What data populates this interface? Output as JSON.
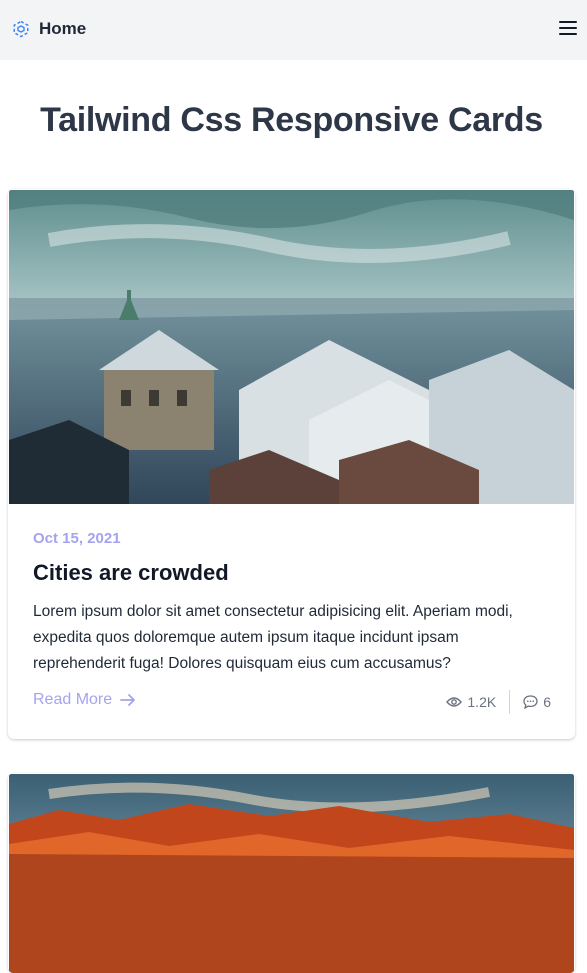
{
  "nav": {
    "brand_label": "Home",
    "brand_icon": "hexagon-cube-icon",
    "menu_icon": "hamburger-menu-icon",
    "accent_color": "#3b82f6"
  },
  "page": {
    "title": "Tailwind Css Responsive Cards"
  },
  "cards": [
    {
      "image": "city-rooftops-photo",
      "date": "Oct 15, 2021",
      "title": "Cities are crowded",
      "text": "Lorem ipsum dolor sit amet consectetur adipisicing elit. Aperiam modi, expedita quos doloremque autem ipsum itaque incidunt ipsam reprehenderit fuga! Dolores quisquam eius cum accusamus?",
      "read_more": "Read More",
      "views": "1.2K",
      "comments": "6"
    },
    {
      "image": "red-rock-landscape-photo"
    }
  ],
  "colors": {
    "date": "#a5a3f0",
    "link": "#a5a3f0",
    "title": "#2d3748"
  }
}
